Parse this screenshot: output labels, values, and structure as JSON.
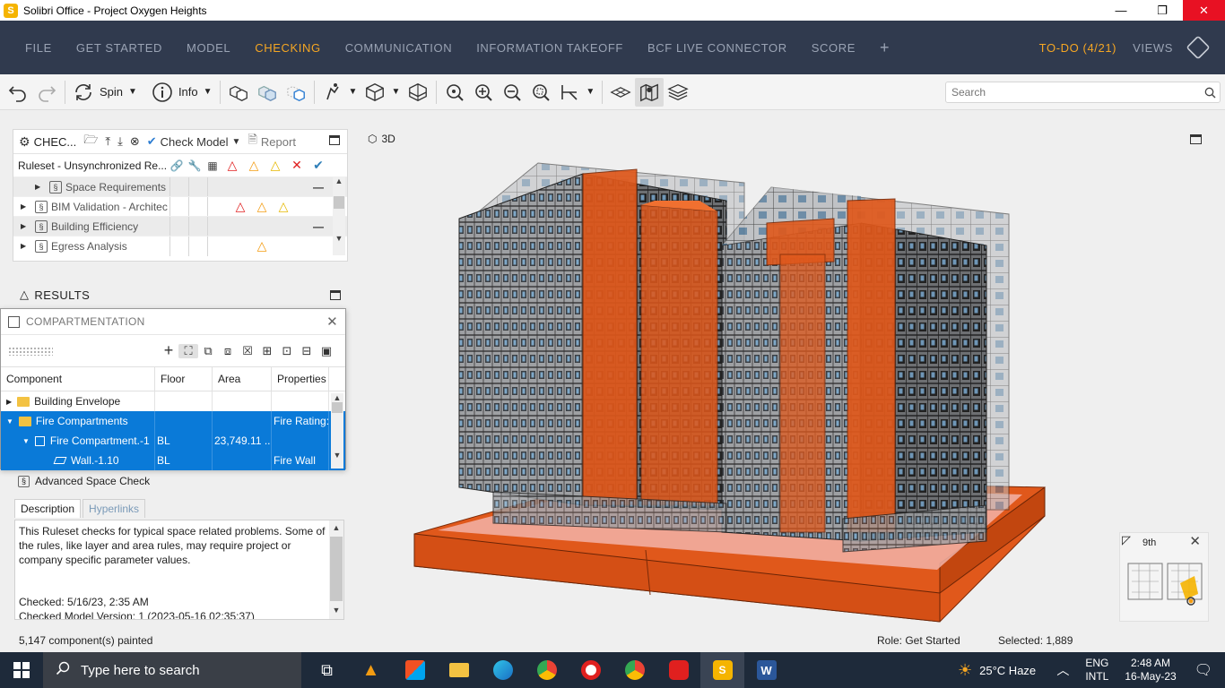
{
  "window": {
    "title": "Solibri Office - Project Oxygen Heights",
    "app_icon": "S",
    "minimize": "—",
    "restore": "❐",
    "close": "✕"
  },
  "menu": {
    "items": [
      "FILE",
      "GET STARTED",
      "MODEL",
      "CHECKING",
      "COMMUNICATION",
      "INFORMATION TAKEOFF",
      "BCF LIVE CONNECTOR",
      "SCORE"
    ],
    "active_index": 3,
    "plus": "+",
    "todo": "TO-DO (4/21)",
    "views": "VIEWS"
  },
  "toolbar": {
    "spin_label": "Spin",
    "info_label": "Info"
  },
  "search": {
    "placeholder": "Search",
    "value": ""
  },
  "checking_panel": {
    "title": "CHEC...",
    "check_model_label": "Check Model",
    "report_label": "Report",
    "ruleset_header": "Ruleset - Unsynchronized Re...",
    "rows": [
      {
        "name": "Space Requirements",
        "indent": 2,
        "alt": true,
        "results": "",
        "dash": true
      },
      {
        "name": "BIM Validation - Architec",
        "indent": 1,
        "alt": false,
        "results": "red-orange-yellow",
        "dash": false
      },
      {
        "name": "Building Efficiency",
        "indent": 1,
        "alt": true,
        "results": "",
        "dash": true
      },
      {
        "name": "Egress Analysis",
        "indent": 1,
        "alt": false,
        "results": "orange",
        "dash": false
      }
    ]
  },
  "results_panel": {
    "title": "RESULTS"
  },
  "compartmentation": {
    "title": "COMPARTMENTATION",
    "columns": [
      "Component",
      "Floor",
      "Area",
      "Properties"
    ],
    "rows": [
      {
        "component": "Building Envelope",
        "floor": "",
        "area": "",
        "properties": "",
        "selected": false,
        "level": 0,
        "icon": "folder"
      },
      {
        "component": "Fire Compartments",
        "floor": "",
        "area": "",
        "properties": "Fire Rating:",
        "selected": true,
        "level": 0,
        "icon": "folder"
      },
      {
        "component": "Fire Compartment.-1",
        "floor": "BL",
        "area": "23,749.11 ...",
        "properties": "",
        "selected": true,
        "level": 1,
        "icon": "compartment"
      },
      {
        "component": "Wall.-1.10",
        "floor": "BL",
        "area": "",
        "properties": "Fire Wall",
        "selected": true,
        "level": 2,
        "icon": "wall"
      }
    ]
  },
  "ruleset_info": {
    "name": "Advanced Space Check",
    "tabs": [
      "Description",
      "Hyperlinks"
    ],
    "description": "This Ruleset checks for typical space related problems. Some of the rules, like layer and area rules, may require project or company specific parameter values.",
    "checked": "Checked: 5/16/23, 2:35 AM",
    "checked_version": "Checked Model Version: 1 (2023-05-16 02:35:37)"
  },
  "view3d": {
    "label": "3D",
    "minimap_floor": "9th"
  },
  "status": {
    "painted": "5,147 component(s) painted",
    "role": "Role: Get Started",
    "selected": "Selected: 1,889"
  },
  "taskbar": {
    "search_placeholder": "Type here to search",
    "weather": "25°C  Haze",
    "lang1": "ENG",
    "lang2": "INTL",
    "time": "2:48 AM",
    "date": "16-May-23"
  },
  "colors": {
    "menu_bg": "#303a4e",
    "accent": "#f5a623",
    "selection": "#0a7ad8",
    "building_orange": "#e0581b"
  }
}
